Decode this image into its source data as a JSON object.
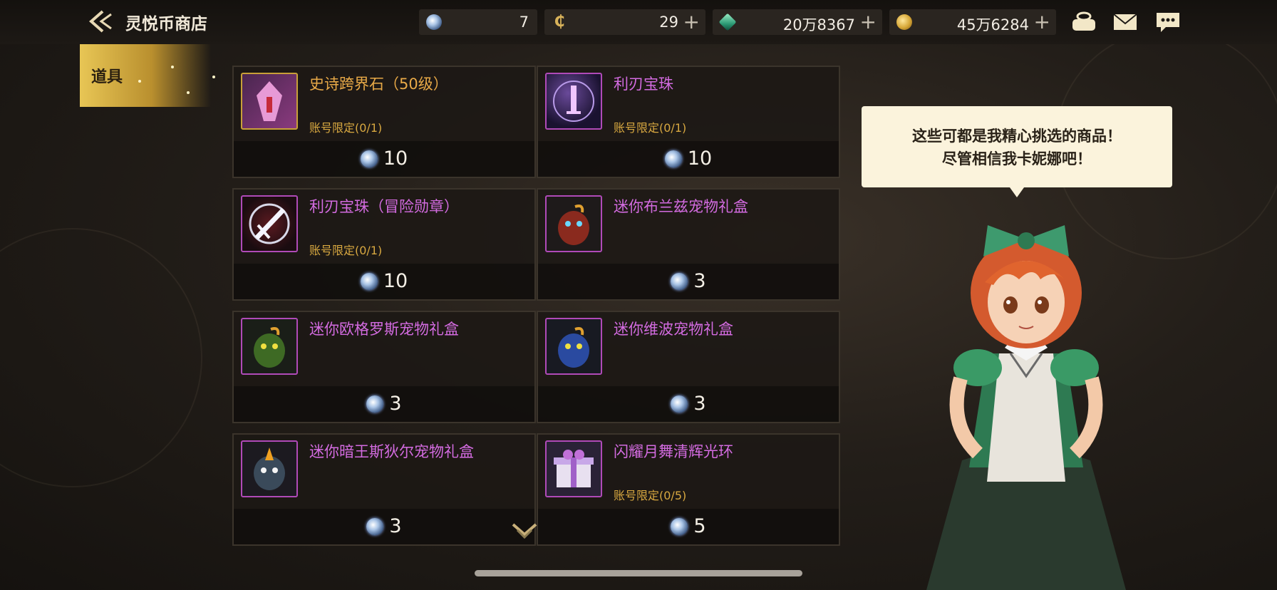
{
  "header": {
    "title": "灵悦币商店",
    "currencies": [
      {
        "icon": "spirit-gem-icon",
        "value": "7",
        "plus": false
      },
      {
        "icon": "coin-c-icon",
        "value": "29",
        "plus": true
      },
      {
        "icon": "green-crystal-icon",
        "value": "20万8367",
        "plus": true
      },
      {
        "icon": "gold-coin-icon",
        "value": "45万6284",
        "plus": true
      }
    ],
    "plus_symbol": "+"
  },
  "tabs": [
    {
      "label": "道具",
      "selected": true
    }
  ],
  "items": [
    {
      "name": "史诗跨界石（50级）",
      "limit": "账号限定(0/1)",
      "price": "10",
      "rarity": "epic",
      "icon": "crossworld-stone-icon"
    },
    {
      "name": "利刃宝珠",
      "limit": "账号限定(0/1)",
      "price": "10",
      "rarity": "unique",
      "icon": "blade-orb-icon"
    },
    {
      "name": "利刃宝珠（冒险勋章）",
      "limit": "账号限定(0/1)",
      "price": "10",
      "rarity": "unique",
      "icon": "blade-orb-medal-icon"
    },
    {
      "name": "迷你布兰兹宠物礼盒",
      "limit": "",
      "price": "3",
      "rarity": "unique",
      "icon": "pet-red-icon"
    },
    {
      "name": "迷你欧格罗斯宠物礼盒",
      "limit": "",
      "price": "3",
      "rarity": "unique",
      "icon": "pet-green-icon"
    },
    {
      "name": "迷你维波宠物礼盒",
      "limit": "",
      "price": "3",
      "rarity": "unique",
      "icon": "pet-blue-icon"
    },
    {
      "name": "迷你暗王斯狄尔宠物礼盒",
      "limit": "",
      "price": "3",
      "rarity": "unique",
      "icon": "pet-dark-icon"
    },
    {
      "name": "闪耀月舞清辉光环",
      "limit": "账号限定(0/5)",
      "price": "5",
      "rarity": "unique",
      "icon": "gift-box-icon"
    }
  ],
  "npc": {
    "speech_line1": "这些可都是我精心挑选的商品！",
    "speech_line2": "尽管相信我卡妮娜吧！"
  },
  "colors": {
    "epic": "#e8a947",
    "unique": "#d36be0",
    "limit": "#d8a840",
    "tab": "#e8c655"
  }
}
